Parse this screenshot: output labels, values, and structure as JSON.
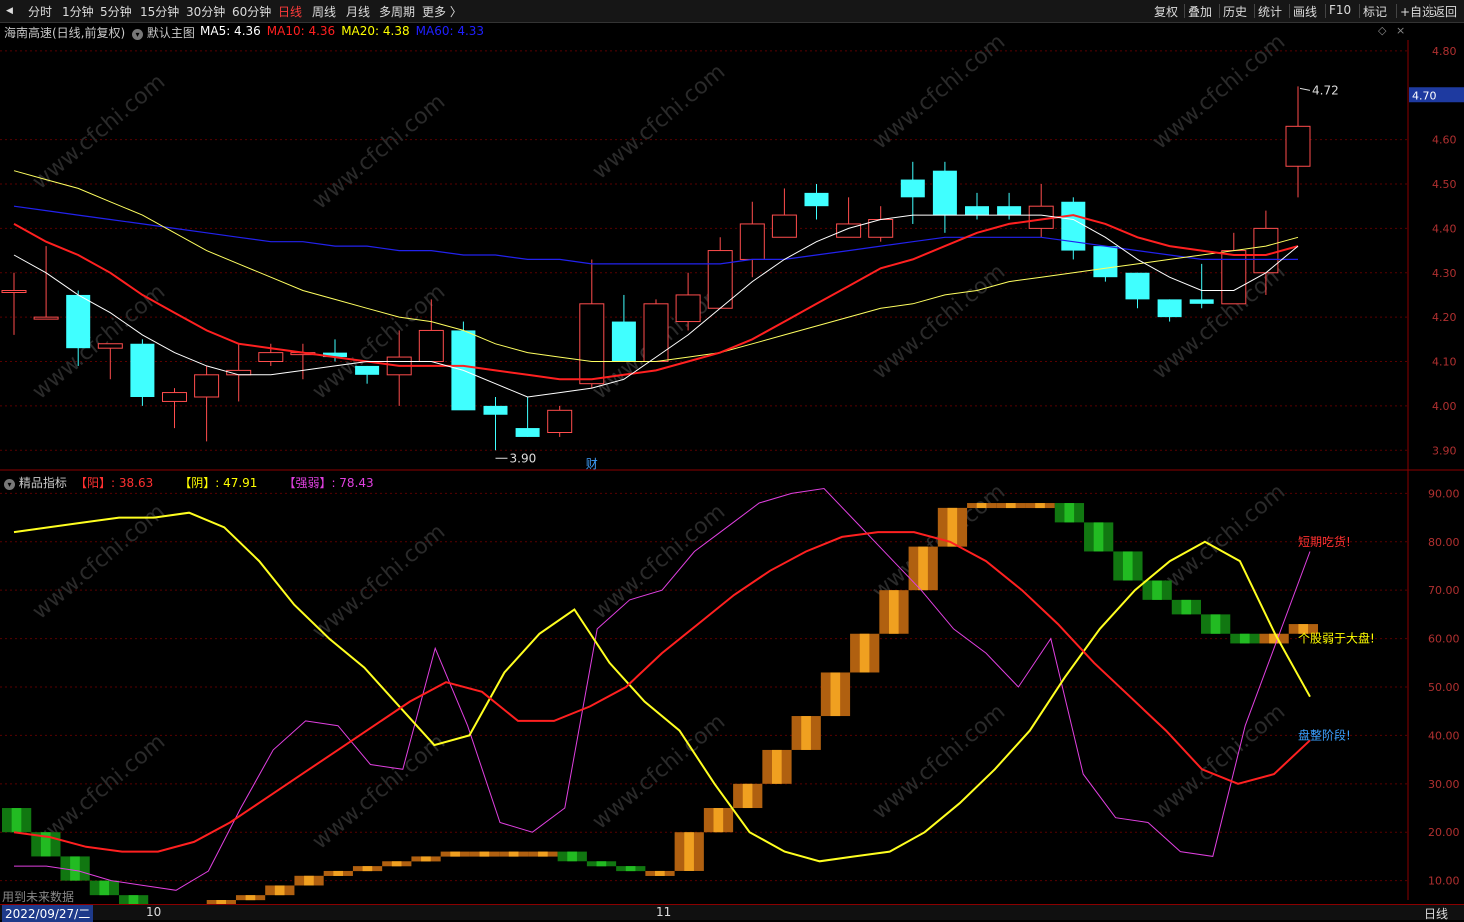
{
  "toolbar": {
    "back_arrow": "◀",
    "periods": [
      "分时",
      "1分钟",
      "5分钟",
      "15分钟",
      "30分钟",
      "60分钟",
      "日线",
      "周线",
      "月线",
      "多周期",
      "更多 〉"
    ],
    "active_period": "日线",
    "right_buttons": [
      "复权",
      "叠加",
      "历史",
      "统计",
      "画线",
      "F10",
      "标记",
      "+自选",
      "返回"
    ]
  },
  "main_panel": {
    "stock_title": "海南高速(日线,前复权)",
    "template_label": "默认主图",
    "ma": [
      {
        "label": "MA5: 4.36",
        "color": "#ffffff"
      },
      {
        "label": "MA10: 4.36",
        "color": "#ff2020"
      },
      {
        "label": "MA20: 4.38",
        "color": "#ffff00"
      },
      {
        "label": "MA60: 4.33",
        "color": "#2020ff"
      }
    ],
    "price_axis": [
      "4.80",
      "4.60",
      "4.50",
      "4.40",
      "4.30",
      "4.20",
      "4.10",
      "4.00",
      "3.90"
    ],
    "last_price_tag": "4.70",
    "high_label": "4.72",
    "low_label": "3.90",
    "finance_marker": "财"
  },
  "sub_panel": {
    "indicator_name": "精品指标",
    "values": [
      {
        "label": "【阳】: 38.63",
        "color": "#ff3030"
      },
      {
        "label": "【阴】: 47.91",
        "color": "#ffff00"
      },
      {
        "label": "【强弱】: 78.43",
        "color": "#e040e0"
      }
    ],
    "axis": [
      "90.00",
      "80.00",
      "70.00",
      "60.00",
      "50.00",
      "40.00",
      "30.00",
      "20.00",
      "10.00"
    ],
    "annotations": [
      {
        "text": "短期吃货!",
        "color": "#ff3030"
      },
      {
        "text": "个股弱于大盘!",
        "color": "#ffff00"
      },
      {
        "text": "盘整阶段!",
        "color": "#3aa0ff"
      }
    ],
    "footer_note": "用到未来数据"
  },
  "bottom": {
    "date": "2022/09/27/二",
    "month_marks": [
      "10",
      "11"
    ],
    "period_label": "日线"
  },
  "watermark": "www.cfchi.com",
  "colors": {
    "up": "#ff4d4d",
    "down": "#40ffff",
    "ma5": "#ffffff",
    "ma10": "#ff2020",
    "ma20": "#ffff60",
    "ma60": "#2222ee"
  },
  "chart_data": {
    "type": "candlestick",
    "candles": [
      {
        "o": 4.26,
        "h": 4.3,
        "l": 4.16,
        "c": 4.26
      },
      {
        "o": 4.2,
        "h": 4.36,
        "l": 4.2,
        "c": 4.2
      },
      {
        "o": 4.25,
        "h": 4.26,
        "l": 4.09,
        "c": 4.13
      },
      {
        "o": 4.13,
        "h": 4.14,
        "l": 4.06,
        "c": 4.14
      },
      {
        "o": 4.14,
        "h": 4.15,
        "l": 4.0,
        "c": 4.02
      },
      {
        "o": 4.01,
        "h": 4.04,
        "l": 3.95,
        "c": 4.03
      },
      {
        "o": 4.02,
        "h": 4.09,
        "l": 3.92,
        "c": 4.07
      },
      {
        "o": 4.07,
        "h": 4.14,
        "l": 4.01,
        "c": 4.08
      },
      {
        "o": 4.1,
        "h": 4.14,
        "l": 4.09,
        "c": 4.12
      },
      {
        "o": 4.12,
        "h": 4.14,
        "l": 4.06,
        "c": 4.12
      },
      {
        "o": 4.12,
        "h": 4.15,
        "l": 4.1,
        "c": 4.11
      },
      {
        "o": 4.09,
        "h": 4.09,
        "l": 4.05,
        "c": 4.07
      },
      {
        "o": 4.07,
        "h": 4.17,
        "l": 4.0,
        "c": 4.11
      },
      {
        "o": 4.1,
        "h": 4.24,
        "l": 4.1,
        "c": 4.17
      },
      {
        "o": 4.17,
        "h": 4.19,
        "l": 4.0,
        "c": 3.99
      },
      {
        "o": 4.0,
        "h": 4.02,
        "l": 3.9,
        "c": 3.98
      },
      {
        "o": 3.95,
        "h": 4.02,
        "l": 3.93,
        "c": 3.93
      },
      {
        "o": 3.94,
        "h": 4.0,
        "l": 3.93,
        "c": 3.99
      },
      {
        "o": 4.05,
        "h": 4.33,
        "l": 4.04,
        "c": 4.23
      },
      {
        "o": 4.19,
        "h": 4.25,
        "l": 4.1,
        "c": 4.1
      },
      {
        "o": 4.1,
        "h": 4.24,
        "l": 4.1,
        "c": 4.23
      },
      {
        "o": 4.19,
        "h": 4.3,
        "l": 4.17,
        "c": 4.25
      },
      {
        "o": 4.22,
        "h": 4.38,
        "l": 4.22,
        "c": 4.35
      },
      {
        "o": 4.33,
        "h": 4.46,
        "l": 4.29,
        "c": 4.41
      },
      {
        "o": 4.38,
        "h": 4.49,
        "l": 4.38,
        "c": 4.43
      },
      {
        "o": 4.48,
        "h": 4.5,
        "l": 4.42,
        "c": 4.45
      },
      {
        "o": 4.38,
        "h": 4.47,
        "l": 4.38,
        "c": 4.41
      },
      {
        "o": 4.38,
        "h": 4.45,
        "l": 4.37,
        "c": 4.42
      },
      {
        "o": 4.51,
        "h": 4.55,
        "l": 4.41,
        "c": 4.47
      },
      {
        "o": 4.53,
        "h": 4.55,
        "l": 4.39,
        "c": 4.43
      },
      {
        "o": 4.45,
        "h": 4.48,
        "l": 4.42,
        "c": 4.43
      },
      {
        "o": 4.45,
        "h": 4.48,
        "l": 4.42,
        "c": 4.43
      },
      {
        "o": 4.4,
        "h": 4.5,
        "l": 4.38,
        "c": 4.45
      },
      {
        "o": 4.46,
        "h": 4.47,
        "l": 4.33,
        "c": 4.35
      },
      {
        "o": 4.36,
        "h": 4.36,
        "l": 4.28,
        "c": 4.29
      },
      {
        "o": 4.3,
        "h": 4.3,
        "l": 4.22,
        "c": 4.24
      },
      {
        "o": 4.24,
        "h": 4.24,
        "l": 4.19,
        "c": 4.2
      },
      {
        "o": 4.24,
        "h": 4.32,
        "l": 4.22,
        "c": 4.23
      },
      {
        "o": 4.23,
        "h": 4.39,
        "l": 4.23,
        "c": 4.35
      },
      {
        "o": 4.3,
        "h": 4.44,
        "l": 4.25,
        "c": 4.4
      },
      {
        "o": 4.54,
        "h": 4.72,
        "l": 4.47,
        "c": 4.63
      }
    ],
    "ma5": [
      4.34,
      4.3,
      4.25,
      4.21,
      4.16,
      4.12,
      4.09,
      4.07,
      4.07,
      4.08,
      4.09,
      4.1,
      4.1,
      4.1,
      4.08,
      4.05,
      4.02,
      4.03,
      4.04,
      4.06,
      4.11,
      4.16,
      4.22,
      4.28,
      4.33,
      4.37,
      4.4,
      4.42,
      4.43,
      4.43,
      4.43,
      4.43,
      4.43,
      4.42,
      4.38,
      4.33,
      4.29,
      4.26,
      4.26,
      4.3,
      4.36
    ],
    "ma10": [
      4.41,
      4.37,
      4.34,
      4.3,
      4.25,
      4.21,
      4.17,
      4.14,
      4.13,
      4.12,
      4.11,
      4.1,
      4.09,
      4.09,
      4.09,
      4.08,
      4.07,
      4.06,
      4.06,
      4.07,
      4.08,
      4.1,
      4.12,
      4.15,
      4.19,
      4.23,
      4.27,
      4.31,
      4.33,
      4.36,
      4.39,
      4.41,
      4.42,
      4.43,
      4.41,
      4.38,
      4.36,
      4.35,
      4.34,
      4.34,
      4.36
    ],
    "ma20": [
      4.53,
      4.51,
      4.49,
      4.46,
      4.43,
      4.39,
      4.35,
      4.32,
      4.29,
      4.26,
      4.24,
      4.22,
      4.2,
      4.19,
      4.17,
      4.14,
      4.12,
      4.11,
      4.1,
      4.1,
      4.1,
      4.11,
      4.12,
      4.14,
      4.16,
      4.18,
      4.2,
      4.22,
      4.23,
      4.25,
      4.26,
      4.28,
      4.29,
      4.3,
      4.31,
      4.32,
      4.33,
      4.34,
      4.35,
      4.36,
      4.38
    ],
    "ma60": [
      4.45,
      4.44,
      4.43,
      4.42,
      4.41,
      4.4,
      4.39,
      4.38,
      4.37,
      4.37,
      4.36,
      4.36,
      4.35,
      4.35,
      4.34,
      4.34,
      4.33,
      4.33,
      4.32,
      4.32,
      4.32,
      4.32,
      4.32,
      4.33,
      4.33,
      4.34,
      4.35,
      4.36,
      4.37,
      4.38,
      4.38,
      4.38,
      4.38,
      4.37,
      4.36,
      4.35,
      4.34,
      4.33,
      4.33,
      4.33,
      4.33
    ],
    "ind_yang": [
      20,
      19,
      17,
      16,
      16,
      18,
      22,
      27,
      32,
      37,
      42,
      47,
      51,
      49,
      43,
      43,
      46,
      50,
      57,
      63,
      69,
      74,
      78,
      81,
      82,
      82,
      80,
      76,
      70,
      63,
      55,
      48,
      41,
      33,
      30,
      32,
      39
    ],
    "ind_yin": [
      82,
      83,
      84,
      85,
      85,
      86,
      83,
      76,
      67,
      60,
      54,
      46,
      38,
      40,
      53,
      61,
      66,
      55,
      47,
      41,
      30,
      20,
      16,
      14,
      15,
      16,
      20,
      26,
      33,
      41,
      52,
      62,
      70,
      76,
      80,
      76,
      61,
      48
    ],
    "ind_qr": [
      13,
      13,
      12,
      10,
      9,
      8,
      12,
      25,
      37,
      43,
      42,
      34,
      33,
      58,
      42,
      22,
      20,
      25,
      62,
      68,
      70,
      78,
      83,
      88,
      90,
      91,
      84,
      77,
      70,
      62,
      57,
      50,
      60,
      32,
      23,
      22,
      16,
      15,
      42,
      60,
      78
    ],
    "ind_bar": [
      25,
      20,
      15,
      10,
      7,
      5,
      4,
      4,
      6,
      7,
      9,
      11,
      12,
      13,
      14,
      15,
      16,
      16,
      16,
      16,
      14,
      13,
      12,
      12,
      20,
      25,
      30,
      37,
      44,
      53,
      61,
      70,
      79,
      87,
      88,
      88,
      88,
      84,
      78,
      72,
      68,
      65,
      61,
      59,
      61,
      63
    ],
    "ylim_price": [
      3.86,
      4.82
    ],
    "ylim_ind": [
      6,
      94
    ]
  }
}
